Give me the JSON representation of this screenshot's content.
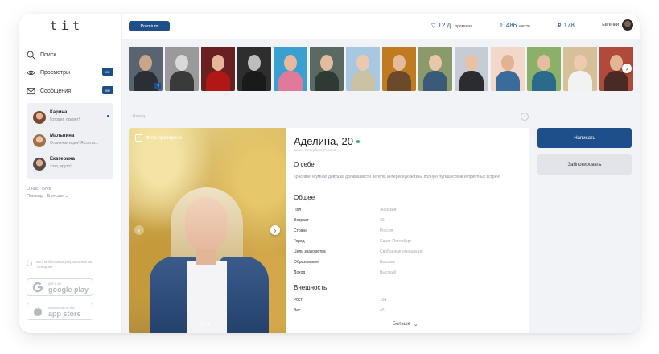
{
  "app": {
    "logo": "tit"
  },
  "sidebar": {
    "nav": [
      {
        "label": "Поиск",
        "icon": "search-icon",
        "badge": ""
      },
      {
        "label": "Просмотры",
        "icon": "eye-icon",
        "badge": "99+"
      },
      {
        "label": "Сообщения",
        "icon": "envelope-icon",
        "badge": "99+"
      }
    ],
    "chats": [
      {
        "name": "Карина",
        "message": "Готовит, привет!",
        "unread": true,
        "avatar_color": "#7a4a30"
      },
      {
        "name": "Мальвина",
        "message": "Отличная идея! Я согла...",
        "unread": false,
        "avatar_color": "#a0704a"
      },
      {
        "name": "Екатерина",
        "message": "хэхэ, круто!",
        "unread": false,
        "avatar_color": "#5a4a44"
      }
    ],
    "links_row1": [
      "О нас",
      "Блог"
    ],
    "links_row2": [
      "Помощь",
      "Больше"
    ],
    "notifications_label": "Вкл. мобильные уведомления на телефоне",
    "stores": [
      {
        "line1": "get it on",
        "line2": "google play",
        "icon": "google-play-icon"
      },
      {
        "line1": "download on the",
        "line2": "app store",
        "icon": "apple-icon"
      }
    ]
  },
  "topbar": {
    "premium_label": "Premium",
    "stats": [
      {
        "icon": "premium-icon",
        "value": "12 д.",
        "label": "премиум"
      },
      {
        "icon": "rank-icon",
        "value": "486",
        "label": "место"
      },
      {
        "icon": "ruble-icon",
        "value": "178",
        "label": ""
      }
    ],
    "user_name": "Евгений"
  },
  "strip": {
    "thumbs": [
      {
        "bg": "#5a6470",
        "skin": "#caa58a",
        "cloth": "#2a2f36",
        "me": true
      },
      {
        "bg": "#9a9a9a",
        "skin": "#d9d9d9",
        "cloth": "#3a3a3a",
        "me": false
      },
      {
        "bg": "#6a2020",
        "skin": "#e6b59a",
        "cloth": "#b01818",
        "me": false
      },
      {
        "bg": "#2e2e2e",
        "skin": "#bdbdbd",
        "cloth": "#1a1a1a",
        "me": false
      },
      {
        "bg": "#3aa0d0",
        "skin": "#e8b99f",
        "cloth": "#e07a9a",
        "me": false
      },
      {
        "bg": "#5a6a62",
        "skin": "#e3bba0",
        "cloth": "#2f3a35",
        "me": false
      },
      {
        "bg": "#a8c7e0",
        "skin": "#ecc8ae",
        "cloth": "#c9c2a4",
        "me": false
      },
      {
        "bg": "#c07a20",
        "skin": "#e5bb9a",
        "cloth": "#6a4a2a",
        "me": false
      },
      {
        "bg": "#8a9a6a",
        "skin": "#eac6aa",
        "cloth": "#3a5a7a",
        "me": false
      },
      {
        "bg": "#c5ccd6",
        "skin": "#e9c2a6",
        "cloth": "#2c2c30",
        "me": false
      },
      {
        "bg": "#f2d8c8",
        "skin": "#e2b392",
        "cloth": "#3b6b9a",
        "me": false
      },
      {
        "bg": "#8ab06a",
        "skin": "#e7bda0",
        "cloth": "#2a6a8a",
        "me": false
      },
      {
        "bg": "#d6c09a",
        "skin": "#edcab0",
        "cloth": "#f2f2f2",
        "me": false
      },
      {
        "bg": "#b04a3a",
        "skin": "#e3b597",
        "cloth": "#4a2a24",
        "me": false
      },
      {
        "bg": "#3a3a3a",
        "skin": "#d0a486",
        "cloth": "#1c1c1c",
        "me": false
      }
    ]
  },
  "profile": {
    "back_label": "Назад",
    "verified_label": "Фото проверено",
    "photo_counter": "1 / 3",
    "name": "Аделина, 20",
    "city": "Санкт-Петербург, Россия",
    "about_title": "О себе",
    "about_text": "Красивая и умная девушка должна вести легкую, интересную жизнь, полную путешествий и приятных встреч!",
    "general_title": "Общее",
    "general": [
      {
        "key": "Пол",
        "value": "Женский"
      },
      {
        "key": "Возраст",
        "value": "20"
      },
      {
        "key": "Страна",
        "value": "Россия"
      },
      {
        "key": "Город",
        "value": "Санкт-Петербург"
      },
      {
        "key": "Цель знакомства",
        "value": "Свободные отношения"
      },
      {
        "key": "Образование",
        "value": "Высшее"
      },
      {
        "key": "Доход",
        "value": "Высокий"
      }
    ],
    "appearance_title": "Внешность",
    "appearance": [
      {
        "key": "Рост",
        "value": "164"
      },
      {
        "key": "Вес",
        "value": "45"
      }
    ],
    "more_label": "Больше"
  },
  "actions": {
    "write_label": "Написать",
    "block_label": "Заблокировать"
  },
  "colors": {
    "accent": "#1f4f8a",
    "online": "#3cb371"
  }
}
